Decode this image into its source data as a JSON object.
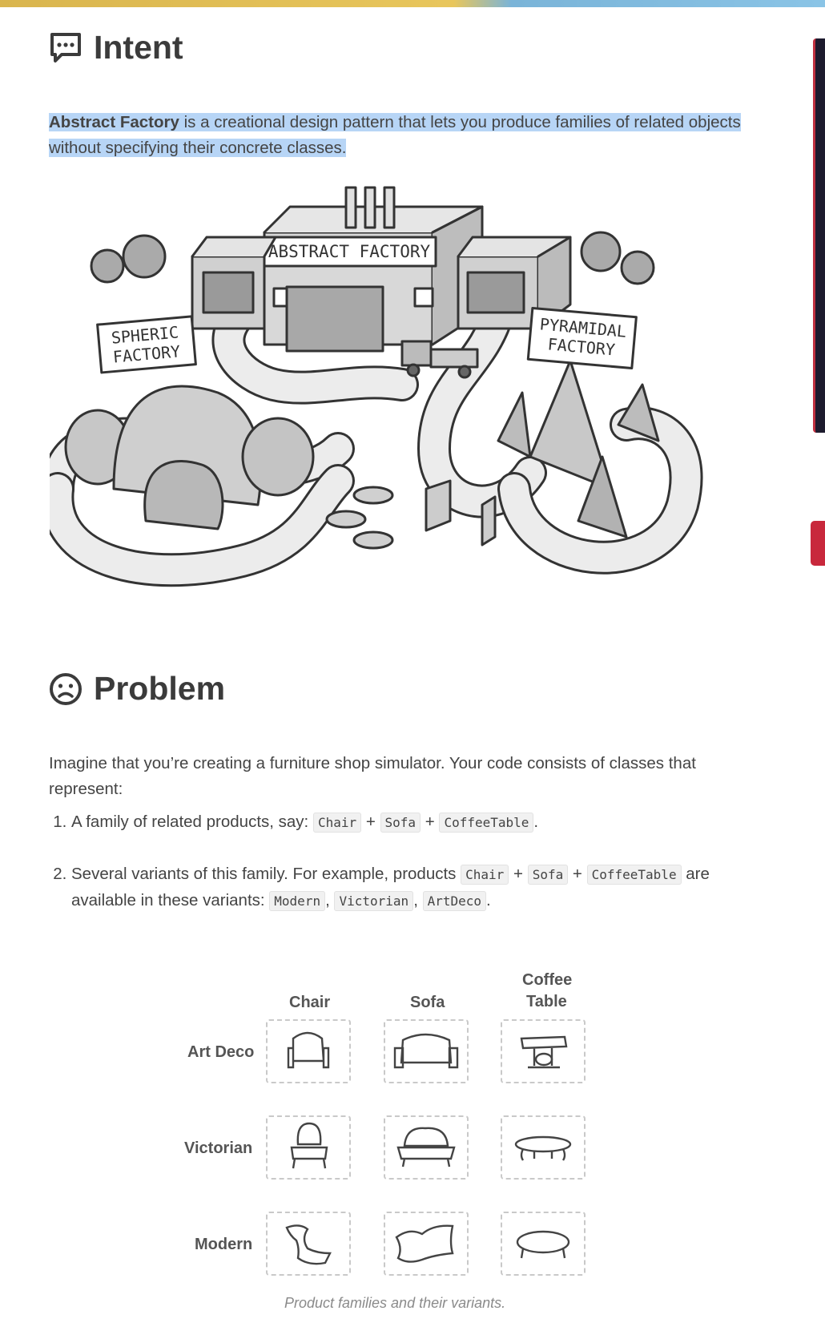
{
  "intent": {
    "heading": "Intent",
    "icon": "speech-bubble-icon",
    "term": "Abstract Factory",
    "text": " is a creational design pattern that lets you produce families of related objects without specifying their concrete classes."
  },
  "illustration": {
    "sign_abstract": "ABSTRACT FACTORY",
    "sign_spheric": [
      "SPHERIC",
      "FACTORY"
    ],
    "sign_pyramidal": [
      "PYRAMIDAL",
      "FACTORY"
    ]
  },
  "problem": {
    "heading": "Problem",
    "icon": "sad-face-icon",
    "paragraph": "Imagine that you’re creating a furniture shop simulator. Your code consists of classes that represent:",
    "item1_text": "A family of related products, say: ",
    "item2_text": "Several variants of this family. For example, products ",
    "item2_mid": " are available in these variants: ",
    "codes": {
      "chair": "Chair",
      "sofa": "Sofa",
      "coffeetable": "CoffeeTable",
      "modern": "Modern",
      "victorian": "Victorian",
      "artdeco": "ArtDeco"
    },
    "plus": "+",
    "comma": ",",
    "period": "."
  },
  "variants": {
    "columns": [
      "Chair",
      "Sofa",
      "Coffee",
      "Table"
    ],
    "rows": [
      "Art Deco",
      "Victorian",
      "Modern"
    ],
    "caption": "Product families and their variants."
  },
  "colors": {
    "highlight": "#b7d5f6",
    "accent_red": "#c8283c"
  }
}
